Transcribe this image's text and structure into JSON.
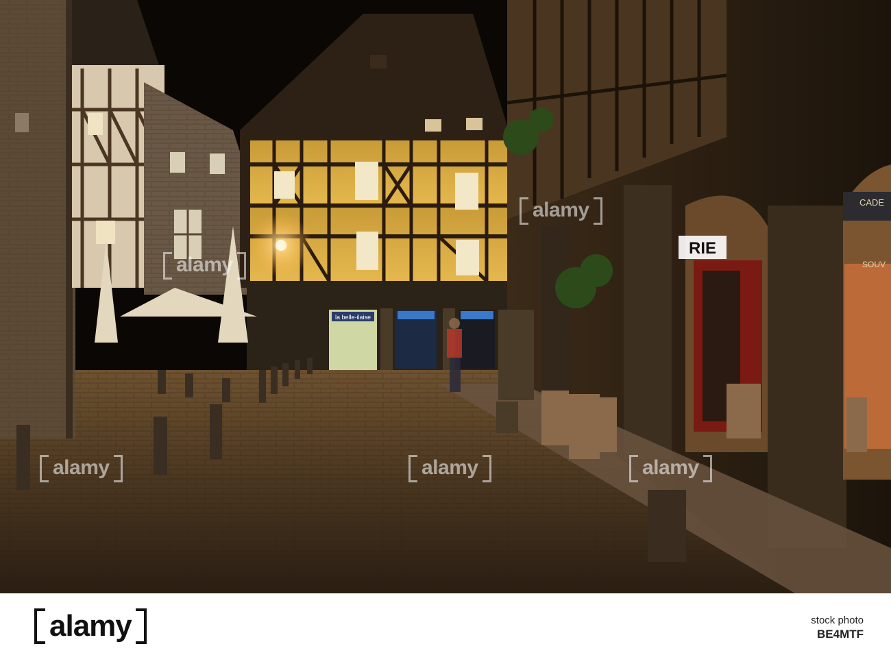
{
  "photo": {
    "subject": "night-street-half-timbered-houses",
    "signs": {
      "shop_left": "la belle-ilaise",
      "shop_right_partial": "RIE",
      "cafe_right_partial": "CADE",
      "souv_partial": "SOUV"
    }
  },
  "watermark": {
    "text": "alamy"
  },
  "footer": {
    "brand": "alamy",
    "stock_label": "stock photo",
    "image_code": "BE4MTF"
  },
  "colors": {
    "lamp_glow": "#f6d27a",
    "timber_dark": "#2a1b0e",
    "plaster_yellow": "#e2b547",
    "night_sky": "#0a0705",
    "cobble": "#5a4226"
  }
}
